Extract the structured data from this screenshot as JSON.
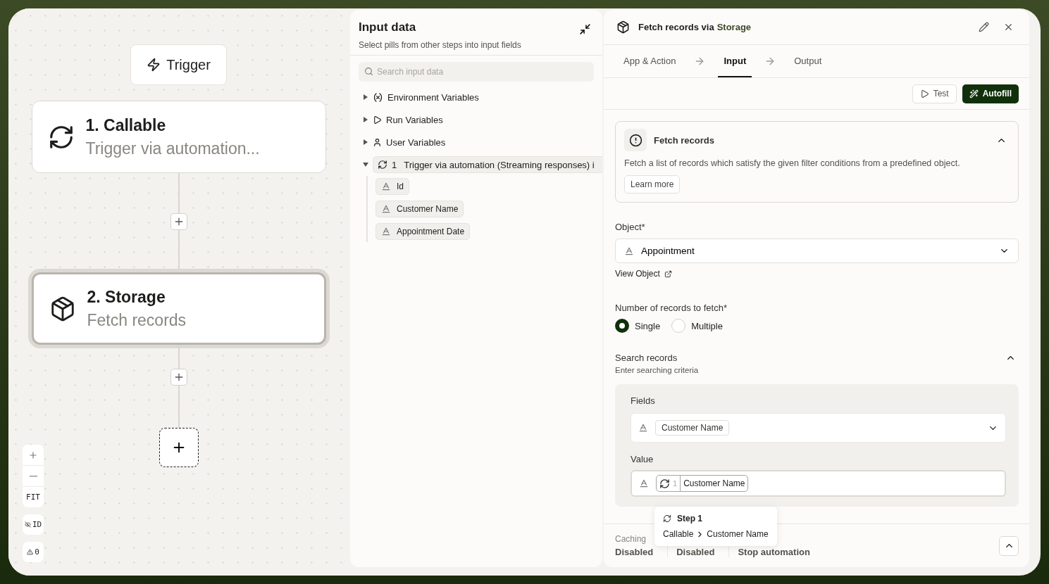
{
  "canvas": {
    "trigger": "Trigger",
    "nodes": [
      {
        "kind": "sync",
        "title": "1. Callable",
        "subtitle": "Trigger via automation...",
        "selected": false
      },
      {
        "kind": "box",
        "title": "2. Storage",
        "subtitle": "Fetch records",
        "selected": true
      }
    ],
    "zoom_controls": {
      "fit": "FIT",
      "id_toggle": "ID",
      "warnings": "0"
    }
  },
  "input_panel": {
    "title": "Input data",
    "subtitle": "Select pills from other steps into input fields",
    "search": {
      "placeholder": "Search input data"
    },
    "tree": [
      {
        "kind": "env",
        "label": "Environment Variables",
        "expanded": false
      },
      {
        "kind": "run",
        "label": "Run Variables",
        "expanded": false
      },
      {
        "kind": "user",
        "label": "User Variables",
        "expanded": false
      },
      {
        "kind": "step",
        "step": "1",
        "label": "Trigger via automation (Streaming responses) i",
        "expanded": true,
        "children": [
          {
            "label": "Id"
          },
          {
            "label": "Customer Name"
          },
          {
            "label": "Appointment Date"
          }
        ]
      }
    ]
  },
  "detail": {
    "title": "Fetch records via",
    "app": "Storage",
    "tabs": [
      {
        "label": "App & Action",
        "selected": false
      },
      {
        "label": "Input",
        "selected": true
      },
      {
        "label": "Output",
        "selected": false
      }
    ],
    "buttons": {
      "test": "Test",
      "autofill": "Autofill"
    },
    "info": {
      "title": "Fetch records",
      "description": "Fetch a list of records which satisfy the given filter conditions from a predefined object.",
      "learn_more": "Learn more",
      "expanded": true
    },
    "object": {
      "label": "Object*",
      "value": "Appointment",
      "link": "View Object"
    },
    "records_count": {
      "label": "Number of records to fetch*",
      "options": [
        {
          "label": "Single",
          "selected": true
        },
        {
          "label": "Multiple",
          "selected": false
        }
      ]
    },
    "search_records": {
      "title": "Search records",
      "subtitle": "Enter searching criteria",
      "expanded": true,
      "fields": {
        "label": "Fields",
        "value": "Customer Name"
      },
      "value": {
        "label": "Value",
        "step": "1",
        "pill": "Customer Name"
      }
    },
    "tooltip": {
      "title": "Step 1",
      "path": [
        "Callable",
        "Customer Name"
      ]
    },
    "footer": [
      {
        "label": "Caching",
        "value": "Disabled"
      },
      {
        "value": "Disabled"
      },
      {
        "value": "Stop automation"
      }
    ]
  }
}
